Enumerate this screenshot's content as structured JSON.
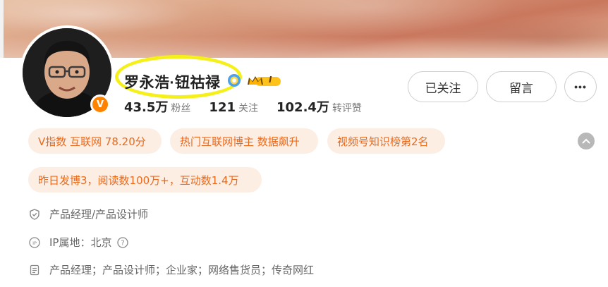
{
  "profile": {
    "name": "罗永浩·钮祜禄",
    "vip_level": "I",
    "stats": [
      {
        "value": "43.5万",
        "label": "粉丝"
      },
      {
        "value": "121",
        "label": "关注"
      },
      {
        "value": "102.4万",
        "label": "转评赞"
      }
    ],
    "verified_badge": "V"
  },
  "actions": {
    "follow_label": "已关注",
    "message_label": "留言",
    "more_label": "•••"
  },
  "tags": [
    "V指数 互联网 78.20分",
    "热门互联网博主 数据飙升",
    "视频号知识榜第2名",
    "昨日发博3，阅读数100万+，互动数1.4万"
  ],
  "info": {
    "title": "产品经理/产品设计师",
    "ip_location": "IP属地：北京",
    "bio": "产品经理；产品设计师；企业家；网络售货员；传奇网红"
  },
  "icons": {
    "verify": "blue-verified-icon",
    "vip": "crown-vip-icon",
    "collapse": "chevron-up-icon",
    "title": "shield-icon",
    "ip": "ip-icon",
    "help": "question-icon",
    "bio": "document-icon"
  },
  "colors": {
    "accent": "#ea6a1c",
    "tag_bg": "#fdeee4",
    "vbadge": "#ff8200",
    "highlight_oval": "#f5ef1a"
  }
}
